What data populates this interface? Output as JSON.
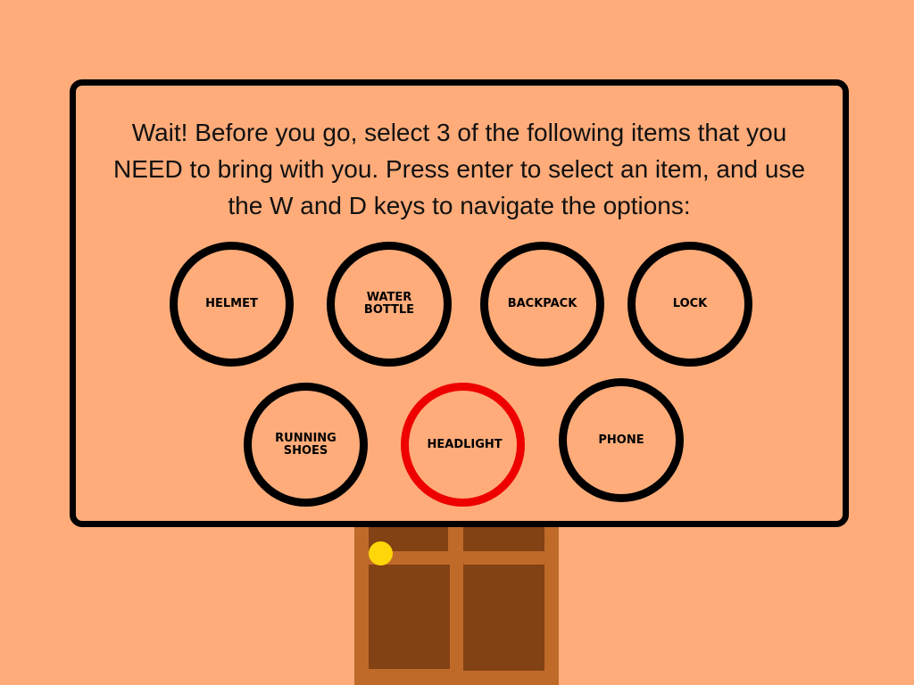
{
  "prompt": "Wait! Before you go, select 3 of the following items that you NEED to bring with you. Press enter to select an item, and use the W and D keys to navigate the options:",
  "options": [
    {
      "label": "HELMET",
      "selected": false
    },
    {
      "label": "WATER BOTTLE",
      "selected": false
    },
    {
      "label": "BACKPACK",
      "selected": false
    },
    {
      "label": "LOCK",
      "selected": false
    },
    {
      "label": "RUNNING SHOES",
      "selected": false
    },
    {
      "label": "HEADLIGHT",
      "selected": true
    },
    {
      "label": "PHONE",
      "selected": false
    }
  ],
  "colors": {
    "background": "#ffac7a",
    "border": "#000000",
    "selected_border": "#ee0000",
    "door": "#c06a2a",
    "door_panel": "#824214",
    "door_knob": "#ffd60a"
  }
}
